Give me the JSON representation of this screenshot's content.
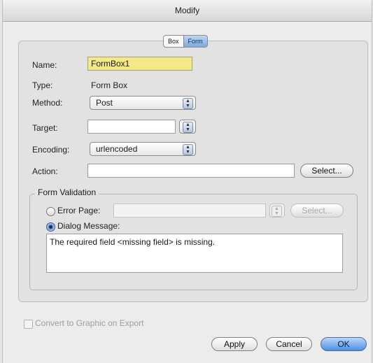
{
  "window": {
    "title": "Modify"
  },
  "tabs": [
    {
      "label": "Box",
      "active": false
    },
    {
      "label": "Form",
      "active": true
    }
  ],
  "form": {
    "name_label": "Name:",
    "name_value": "FormBox1",
    "type_label": "Type:",
    "type_value": "Form Box",
    "method_label": "Method:",
    "method_value": "Post",
    "target_label": "Target:",
    "target_value": "",
    "encoding_label": "Encoding:",
    "encoding_value": "urlencoded",
    "action_label": "Action:",
    "action_value": "",
    "select_label": "Select..."
  },
  "validation": {
    "group_title": "Form Validation",
    "error_page_label": "Error Page:",
    "error_page_value": "",
    "error_select_label": "Select...",
    "dialog_message_label": "Dialog Message:",
    "dialog_message_value": "The required field <missing field> is missing.",
    "selected": "dialog_message"
  },
  "footer": {
    "convert_label": "Convert to Graphic on Export",
    "convert_checked": false,
    "apply_label": "Apply",
    "cancel_label": "Cancel",
    "ok_label": "OK"
  },
  "colors": {
    "name_field_bg": "#f4e889",
    "ok_button": "#4f8fe0"
  }
}
